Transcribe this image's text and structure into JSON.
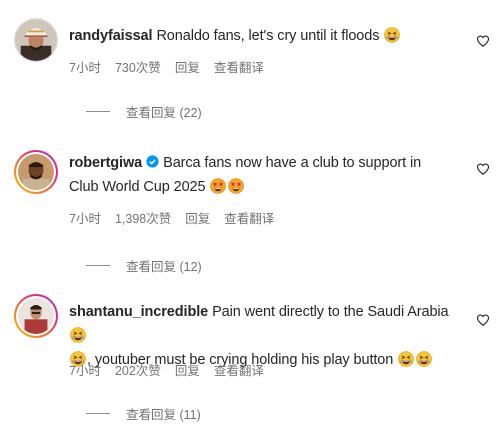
{
  "comments": [
    {
      "username": "randyfaissal",
      "text": "Ronaldo fans, let's cry until it floods",
      "emojis": [
        "grinning-squinting-face"
      ],
      "verified": false,
      "time": "7小时",
      "likes": "730次赞",
      "reply": "回复",
      "translate": "查看翻译",
      "view_replies": "查看回复 (22)",
      "avatar_icon": "avatar-man-headdress"
    },
    {
      "username": "robertgiwa",
      "text": "Barca fans now have a club to support in Club World Cup 2025",
      "emojis": [
        "star-struck-face",
        "star-struck-face"
      ],
      "verified": true,
      "time": "7小时",
      "likes": "1,398次赞",
      "reply": "回复",
      "translate": "查看翻译",
      "view_replies": "查看回复 (12)",
      "avatar_icon": "avatar-man-portrait"
    },
    {
      "username": "shantanu_incredible",
      "text_part1": "Pain went directly to the Saudi Arabia",
      "text_part2": ", youtuber must be crying holding his play button",
      "emojis": [
        "grinning-squinting-face",
        "grinning-squinting-face",
        "grinning-squinting-face",
        "grinning-squinting-face"
      ],
      "verified": false,
      "time": "7小时",
      "likes": "202次赞",
      "reply": "回复",
      "translate": "查看翻译",
      "view_replies": "查看回复 (11)",
      "avatar_icon": "avatar-man-portrait"
    }
  ],
  "colors": {
    "text": "#262626",
    "secondary": "#737373",
    "verified": "#0095f6",
    "story_ring": [
      "#f9c200",
      "#e32d79",
      "#c026d3"
    ]
  },
  "icons": [
    "heart-outline-icon",
    "verified-badge-icon"
  ]
}
